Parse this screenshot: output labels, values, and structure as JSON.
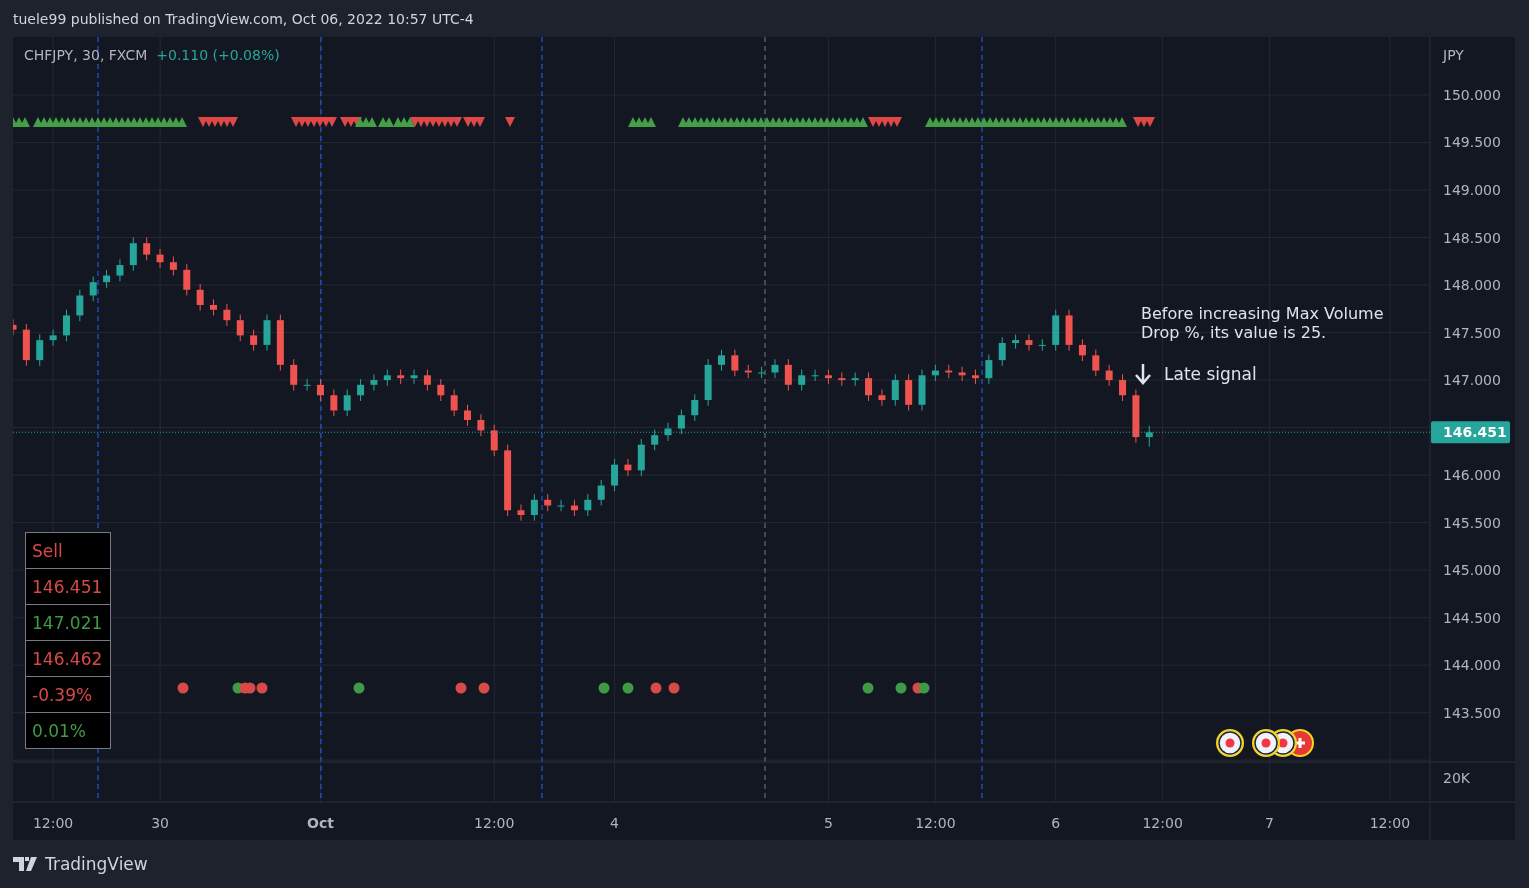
{
  "header": {
    "text": "tuele99 published on TradingView.com, Oct 06, 2022 10:57 UTC-4"
  },
  "legend": {
    "symbol": "CHFJPY, 30, FXCM",
    "change": "+0.110 (+0.08%)"
  },
  "price_axis": {
    "currency": "JPY",
    "volume_label": "20K"
  },
  "chart_data": {
    "type": "candlestick",
    "grid": true,
    "ylim": [
      142.56,
      150.61
    ],
    "yticks": [
      {
        "value": 143.5,
        "label": "143.500"
      },
      {
        "value": 144,
        "label": "144.000"
      },
      {
        "value": 144.5,
        "label": "144.500"
      },
      {
        "value": 145,
        "label": "145.000"
      },
      {
        "value": 145.5,
        "label": "145.500"
      },
      {
        "value": 146,
        "label": "146.000"
      },
      {
        "value": 147,
        "label": "147.000"
      },
      {
        "value": 147.5,
        "label": "147.500"
      },
      {
        "value": 148,
        "label": "148.000"
      },
      {
        "value": 148.5,
        "label": "148.500"
      },
      {
        "value": 149,
        "label": "149.000"
      },
      {
        "value": 149.5,
        "label": "149.500"
      },
      {
        "value": 150,
        "label": "150.000"
      }
    ],
    "categories": [
      null,
      null,
      null,
      "12:00",
      null,
      null,
      null,
      null,
      null,
      null,
      null,
      "30",
      null,
      null,
      null,
      null,
      null,
      null,
      null,
      null,
      null,
      null,
      null,
      "Oct",
      null,
      null,
      null,
      null,
      null,
      null,
      null,
      null,
      null,
      null,
      null,
      null,
      "12:00",
      null,
      null,
      null,
      null,
      null,
      null,
      null,
      null,
      "4",
      null,
      null,
      null,
      null,
      null,
      null,
      null,
      null,
      null,
      null,
      null,
      null,
      null,
      null,
      null,
      "5",
      null,
      null,
      null,
      null,
      null,
      null,
      null,
      "12:00",
      null,
      null,
      null,
      null,
      null,
      null,
      null,
      null,
      "6",
      null,
      null,
      null,
      null,
      null,
      null,
      null,
      "12:00",
      null,
      null,
      null,
      null,
      null,
      null,
      null,
      "7",
      null,
      null,
      null,
      null,
      null,
      null,
      null,
      null,
      "12:00",
      null,
      null
    ],
    "ohlc": [
      [
        147.58,
        147.64,
        147.47,
        147.53
      ],
      [
        147.53,
        147.59,
        147.15,
        147.21
      ],
      [
        147.21,
        147.48,
        147.15,
        147.42
      ],
      [
        147.42,
        147.53,
        147.36,
        147.47
      ],
      [
        147.47,
        147.74,
        147.41,
        147.68
      ],
      [
        147.68,
        147.95,
        147.62,
        147.89
      ],
      [
        147.89,
        148.09,
        147.83,
        148.03
      ],
      [
        148.03,
        148.16,
        147.97,
        148.1
      ],
      [
        148.1,
        148.27,
        148.04,
        148.21
      ],
      [
        148.21,
        148.5,
        148.15,
        148.44
      ],
      [
        148.44,
        148.5,
        148.26,
        148.32
      ],
      [
        148.32,
        148.38,
        148.18,
        148.24
      ],
      [
        148.24,
        148.3,
        148.1,
        148.16
      ],
      [
        148.16,
        148.22,
        147.89,
        147.95
      ],
      [
        147.95,
        148.01,
        147.73,
        147.79
      ],
      [
        147.79,
        147.85,
        147.68,
        147.74
      ],
      [
        147.74,
        147.8,
        147.57,
        147.63
      ],
      [
        147.63,
        147.69,
        147.41,
        147.47
      ],
      [
        147.47,
        147.53,
        147.31,
        147.37
      ],
      [
        147.37,
        147.69,
        147.31,
        147.63
      ],
      [
        147.63,
        147.69,
        147.1,
        147.16
      ],
      [
        147.16,
        147.22,
        146.89,
        146.95
      ],
      [
        146.95,
        147.01,
        146.89,
        146.95
      ],
      [
        146.95,
        147.01,
        146.78,
        146.84
      ],
      [
        146.84,
        146.9,
        146.62,
        146.68
      ],
      [
        146.68,
        146.9,
        146.62,
        146.84
      ],
      [
        146.84,
        147.01,
        146.78,
        146.95
      ],
      [
        146.95,
        147.06,
        146.89,
        147.0
      ],
      [
        147.0,
        147.11,
        146.94,
        147.05
      ],
      [
        147.05,
        147.11,
        146.96,
        147.02
      ],
      [
        147.02,
        147.11,
        146.96,
        147.05
      ],
      [
        147.05,
        147.11,
        146.89,
        146.95
      ],
      [
        146.95,
        147.01,
        146.78,
        146.84
      ],
      [
        146.84,
        146.9,
        146.62,
        146.68
      ],
      [
        146.68,
        146.74,
        146.52,
        146.58
      ],
      [
        146.58,
        146.64,
        146.41,
        146.47
      ],
      [
        146.47,
        146.53,
        146.2,
        146.26
      ],
      [
        146.26,
        146.32,
        145.57,
        145.63
      ],
      [
        145.63,
        145.69,
        145.52,
        145.58
      ],
      [
        145.58,
        145.8,
        145.52,
        145.74
      ],
      [
        145.74,
        145.8,
        145.62,
        145.68
      ],
      [
        145.68,
        145.74,
        145.62,
        145.68
      ],
      [
        145.68,
        145.74,
        145.57,
        145.63
      ],
      [
        145.63,
        145.8,
        145.57,
        145.74
      ],
      [
        145.74,
        145.95,
        145.68,
        145.89
      ],
      [
        145.89,
        146.17,
        145.83,
        146.11
      ],
      [
        146.11,
        146.17,
        145.99,
        146.05
      ],
      [
        146.05,
        146.38,
        145.99,
        146.32
      ],
      [
        146.32,
        146.48,
        146.26,
        146.42
      ],
      [
        146.42,
        146.55,
        146.36,
        146.49
      ],
      [
        146.49,
        146.69,
        146.43,
        146.63
      ],
      [
        146.63,
        146.85,
        146.57,
        146.79
      ],
      [
        146.79,
        147.22,
        146.73,
        147.16
      ],
      [
        147.16,
        147.32,
        147.1,
        147.26
      ],
      [
        147.26,
        147.32,
        147.04,
        147.1
      ],
      [
        147.1,
        147.16,
        147.02,
        147.08
      ],
      [
        147.08,
        147.14,
        147.02,
        147.08
      ],
      [
        147.08,
        147.22,
        147.02,
        147.16
      ],
      [
        147.16,
        147.22,
        146.89,
        146.95
      ],
      [
        146.95,
        147.11,
        146.89,
        147.05
      ],
      [
        147.05,
        147.11,
        146.99,
        147.05
      ],
      [
        147.05,
        147.11,
        146.96,
        147.02
      ],
      [
        147.02,
        147.08,
        146.94,
        147.0
      ],
      [
        147.0,
        147.08,
        146.94,
        147.02
      ],
      [
        147.02,
        147.08,
        146.78,
        146.84
      ],
      [
        146.84,
        146.9,
        146.73,
        146.79
      ],
      [
        146.79,
        147.06,
        146.73,
        147.0
      ],
      [
        147.0,
        147.06,
        146.68,
        146.74
      ],
      [
        146.74,
        147.11,
        146.68,
        147.05
      ],
      [
        147.05,
        147.16,
        146.99,
        147.1
      ],
      [
        147.1,
        147.16,
        147.02,
        147.08
      ],
      [
        147.08,
        147.14,
        146.99,
        147.05
      ],
      [
        147.05,
        147.11,
        146.96,
        147.02
      ],
      [
        147.02,
        147.27,
        146.96,
        147.21
      ],
      [
        147.21,
        147.45,
        147.15,
        147.39
      ],
      [
        147.39,
        147.48,
        147.33,
        147.42
      ],
      [
        147.42,
        147.48,
        147.31,
        147.37
      ],
      [
        147.37,
        147.43,
        147.31,
        147.37
      ],
      [
        147.37,
        147.74,
        147.31,
        147.68
      ],
      [
        147.68,
        147.74,
        147.31,
        147.37
      ],
      [
        147.37,
        147.43,
        147.2,
        147.26
      ],
      [
        147.26,
        147.32,
        147.04,
        147.1
      ],
      [
        147.1,
        147.16,
        146.94,
        147.0
      ],
      [
        147.0,
        147.06,
        146.78,
        146.84
      ],
      [
        146.84,
        146.9,
        146.34,
        146.4
      ],
      [
        146.4,
        146.52,
        146.3,
        146.45
      ],
      null,
      null,
      null,
      null,
      null,
      null,
      null,
      null,
      null,
      null,
      null,
      null,
      null,
      null,
      null,
      null,
      null,
      null,
      null,
      null
    ]
  },
  "price_line": {
    "label": "146.451"
  },
  "dividers": [
    {
      "kind": "session"
    },
    {
      "kind": "session"
    },
    {
      "kind": "session"
    },
    {
      "kind": "day"
    },
    {
      "kind": "session"
    }
  ],
  "triangle_runs": [
    {
      "kind": "up"
    },
    {
      "kind": "up"
    },
    {
      "kind": "down"
    },
    {
      "kind": "down"
    },
    {
      "kind": "down"
    },
    {
      "kind": "up"
    },
    {
      "kind": "up"
    },
    {
      "kind": "up"
    },
    {
      "kind": "down"
    },
    {
      "kind": "down"
    },
    {
      "kind": "down"
    },
    {
      "kind": "up"
    },
    {
      "kind": "up"
    },
    {
      "kind": "down"
    },
    {
      "kind": "up"
    },
    {
      "kind": "down"
    }
  ],
  "dots": [
    {
      "color": "#d84a4a"
    },
    {
      "color": "#3f9a48"
    },
    {
      "color": "#d84a4a"
    },
    {
      "color": "#d84a4a"
    },
    {
      "color": "#d84a4a"
    },
    {
      "color": "#3f9a48"
    },
    {
      "color": "#d84a4a"
    },
    {
      "color": "#d84a4a"
    },
    {
      "color": "#3f9a48"
    },
    {
      "color": "#3f9a48"
    },
    {
      "color": "#d84a4a"
    },
    {
      "color": "#d84a4a"
    },
    {
      "color": "#3f9a48"
    },
    {
      "color": "#3f9a48"
    },
    {
      "color": "#d84a4a"
    },
    {
      "color": "#3f9a48"
    }
  ],
  "events": [
    {
      "kind": "dot"
    },
    {
      "kind": "dot"
    },
    {
      "kind": "dot"
    },
    {
      "kind": "plus"
    }
  ],
  "signal_table": [
    {
      "text": "Sell",
      "color": "#d84a4a"
    },
    {
      "text": "146.451",
      "color": "#d84a4a"
    },
    {
      "text": "147.021",
      "color": "#3f9a48"
    },
    {
      "text": "146.462",
      "color": "#d84a4a"
    },
    {
      "text": "-0.39%",
      "color": "#d84a4a"
    },
    {
      "text": "0.01%",
      "color": "#3f9a48"
    }
  ],
  "notes": [
    {
      "kind": "text",
      "text": "Before increasing Max Volume Drop %, its value is 25."
    },
    {
      "kind": "arrow",
      "text": "Late signal"
    }
  ],
  "footer": {
    "brand": "TradingView"
  }
}
